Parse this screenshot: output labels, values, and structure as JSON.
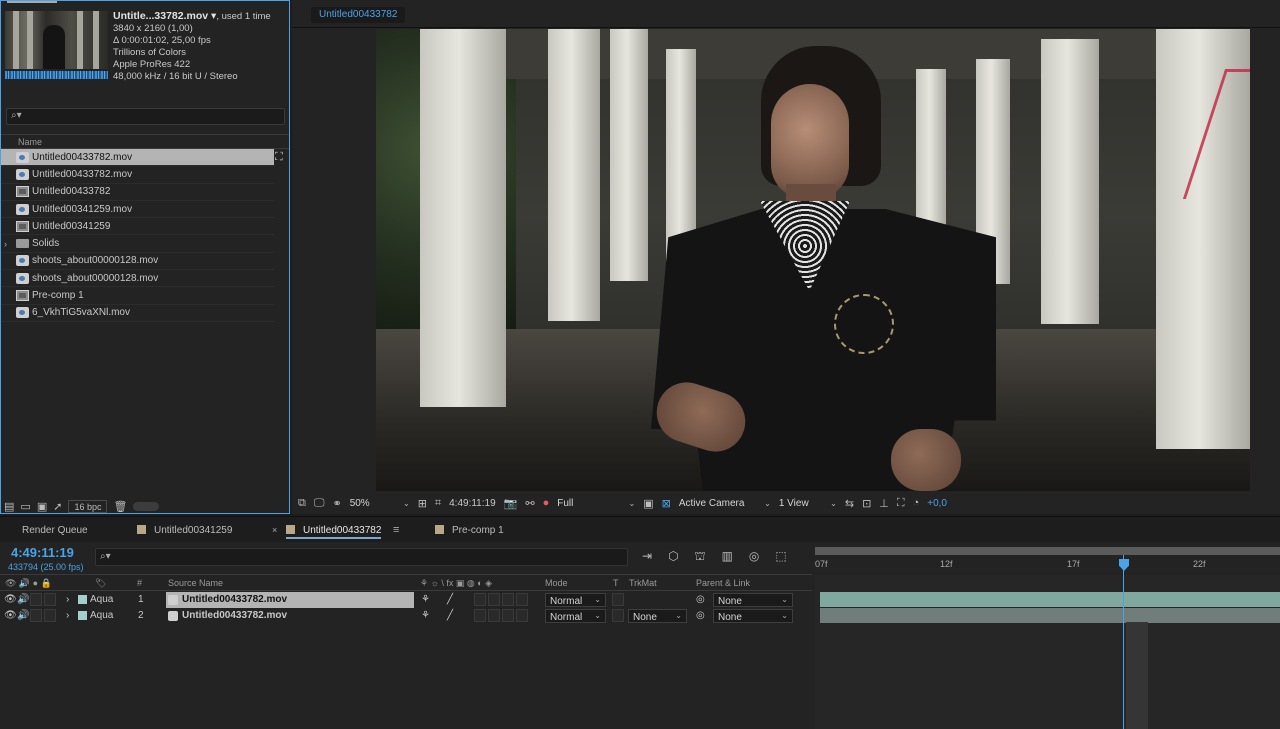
{
  "project": {
    "info": {
      "name": "Untitle...33782.mov ▾",
      "used": ", used 1 time",
      "resolution": "3840 x 2160 (1,00)",
      "duration": "Δ 0:00:01:02, 25,00 fps",
      "colors": "Trillions of Colors",
      "codec": "Apple ProRes 422",
      "audio": "48,000 kHz / 16 bit U / Stereo"
    },
    "search_icon": "⌕▾",
    "column_name": "Name",
    "items": [
      {
        "label": "Untitled00433782.mov",
        "type": "footage"
      },
      {
        "label": "Untitled00433782.mov",
        "type": "footage"
      },
      {
        "label": "Untitled00433782",
        "type": "comp"
      },
      {
        "label": "Untitled00341259.mov",
        "type": "footage"
      },
      {
        "label": "Untitled00341259",
        "type": "comp"
      },
      {
        "label": "Solids",
        "type": "folder"
      },
      {
        "label": "shoots_about00000128.mov",
        "type": "footage"
      },
      {
        "label": "shoots_about00000128.mov",
        "type": "footage"
      },
      {
        "label": "Pre-comp 1",
        "type": "comp"
      },
      {
        "label": "6_VkhTiG5vaXNl.mov",
        "type": "footage"
      }
    ],
    "bpc": "16 bpc"
  },
  "composition": {
    "tab": "Untitled00433782",
    "zoom": "50%",
    "timecode": "4:49:11:19",
    "resolution": "Full",
    "camera": "Active Camera",
    "views": "1 View",
    "exposure": "+0,0"
  },
  "timeline": {
    "tabs": [
      "Render Queue",
      "Untitled00341259",
      "Untitled00433782",
      "Pre-comp 1"
    ],
    "close_glyph": "×",
    "menu_glyph": "≡",
    "timecode": "4:49:11:19",
    "framecount": "433794 (25.00 fps)",
    "search_icon": "⌕▾",
    "columns": {
      "label": "",
      "num": "#",
      "source": "Source Name",
      "switches": "⚘ ☼ \\ fx ▣ ◍ ◐ ◈",
      "mode": "Mode",
      "t": "T",
      "trkmat": "TrkMat",
      "parent": "Parent & Link"
    },
    "layers": [
      {
        "label": "Aqua",
        "num": "1",
        "name": "Untitled00433782.mov",
        "mode": "Normal",
        "trkmat": "",
        "parent": "None"
      },
      {
        "label": "Aqua",
        "num": "2",
        "name": "Untitled00433782.mov",
        "mode": "Normal",
        "trkmat": "None",
        "parent": "None"
      }
    ],
    "ruler_labels": [
      "07f",
      "12f",
      "17f",
      "22f"
    ]
  },
  "colors": {
    "accent": "#4aa3e8",
    "label_aqua": "#a3d0cc",
    "track": "#7fa89f"
  }
}
